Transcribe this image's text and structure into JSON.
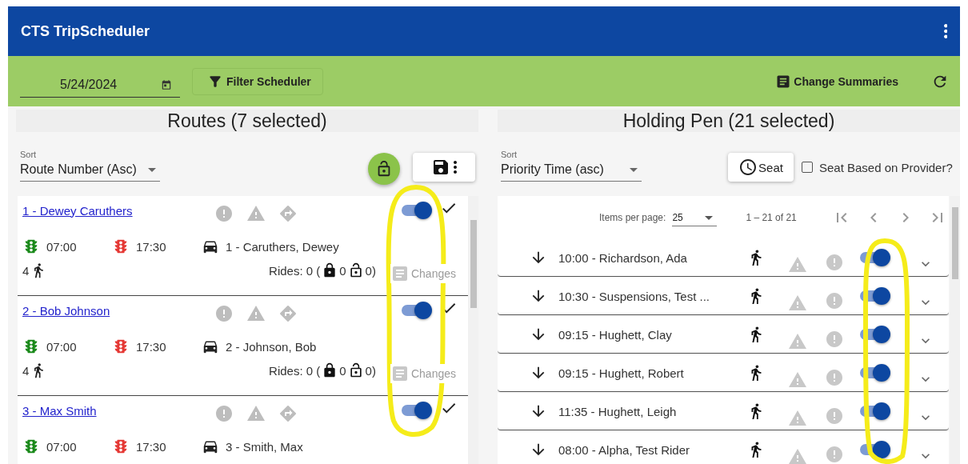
{
  "app_bar": {
    "title": "CTS TripScheduler"
  },
  "toolbar": {
    "date": "5/24/2024",
    "filter_button": "Filter Scheduler",
    "summaries_button": "Change Summaries"
  },
  "routes": {
    "title": "Routes (7 selected)",
    "sort_label": "Sort",
    "sort_value": "Route Number (Asc)",
    "items": [
      {
        "name": "1 - Dewey Caruthers",
        "start": "07:00",
        "end": "17:30",
        "driver": "1 - Caruthers, Dewey",
        "passengers": "4",
        "rides": "Rides: 0 (",
        "locked": "0",
        "unlocked": "0)",
        "changes": "Changes",
        "on": true
      },
      {
        "name": "2 - Bob Johnson",
        "start": "07:00",
        "end": "17:30",
        "driver": "2 - Johnson, Bob",
        "passengers": "4",
        "rides": "Rides: 0 (",
        "locked": "0",
        "unlocked": "0)",
        "changes": "Changes",
        "on": true
      },
      {
        "name": "3 - Max Smith",
        "start": "07:00",
        "end": "17:30",
        "driver": "3 - Smith, Max",
        "on": true
      }
    ]
  },
  "holding_pen": {
    "title": "Holding Pen (21 selected)",
    "sort_label": "Sort",
    "sort_value": "Priority Time (asc)",
    "seat_button": "Seat",
    "provider_checkbox": {
      "label": "Seat Based on Provider?",
      "checked": false
    },
    "paginator": {
      "label": "Items per page:",
      "page_size": "25",
      "range": "1 – 21 of 21"
    },
    "trips": [
      {
        "label": "10:00 - Richardson, Ada",
        "on": true
      },
      {
        "label": "10:30 - Suspensions, Test ...",
        "on": true
      },
      {
        "label": "09:15 - Hughett, Clay",
        "on": true
      },
      {
        "label": "09:15 - Hughett, Robert",
        "on": true
      },
      {
        "label": "11:35 - Hughett, Leigh",
        "on": true
      },
      {
        "label": "08:00 - Alpha, Test Rider",
        "on": true
      }
    ]
  }
}
